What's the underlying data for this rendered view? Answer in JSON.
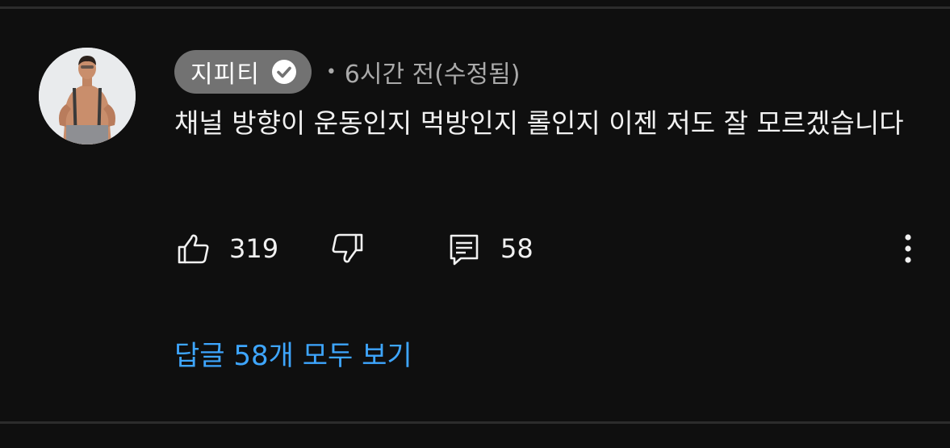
{
  "comment": {
    "author": "지피티",
    "verified_icon": "verified-check-icon",
    "meta_separator": "•",
    "timestamp": "6시간 전(수정됨)",
    "text": "채널 방향이 운동인지 먹방인지 롤인지 이젠 저도 잘 모르겠습니다"
  },
  "actions": {
    "like_icon": "thumbs-up-icon",
    "like_count": "319",
    "dislike_icon": "thumbs-down-icon",
    "reply_icon": "comment-icon",
    "reply_count": "58",
    "more_icon": "more-vertical-icon"
  },
  "replies": {
    "label": "답글 58개 모두 보기"
  },
  "colors": {
    "background": "#0f0f0f",
    "author_chip": "#727272",
    "link": "#3ea6ff",
    "secondary_text": "#aaaaaa"
  }
}
